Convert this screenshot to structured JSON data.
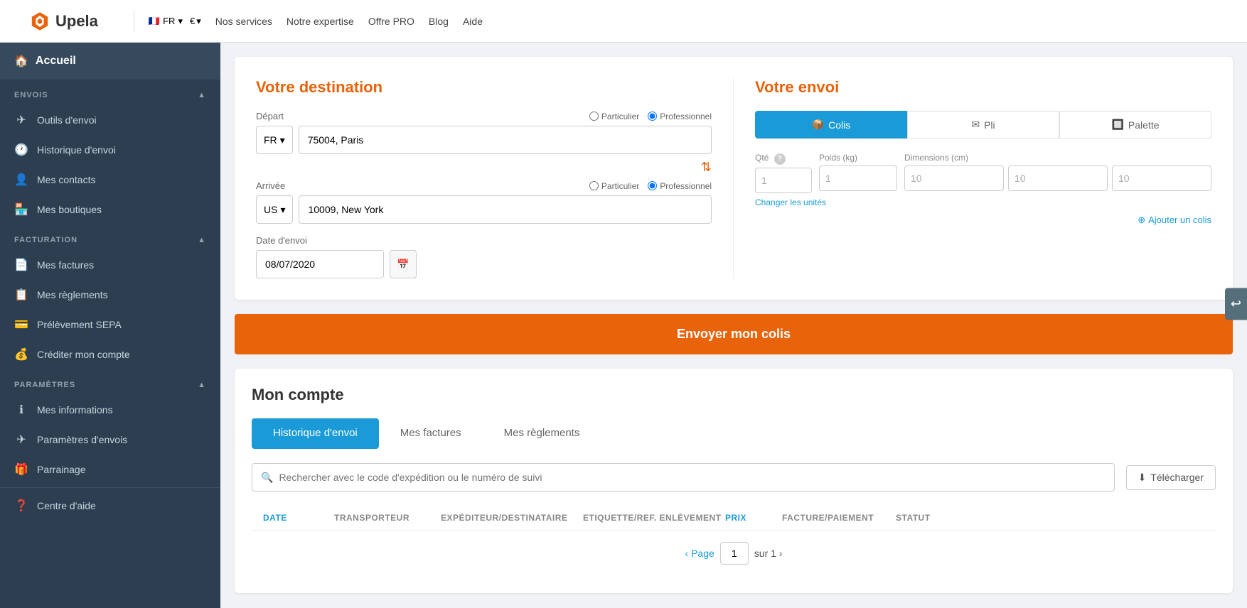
{
  "nav": {
    "logo_text": "Upela",
    "lang": "FR",
    "currency": "€",
    "links": [
      "Nos services",
      "Notre expertise",
      "Offre PRO",
      "Blog",
      "Aide"
    ]
  },
  "sidebar": {
    "home_label": "Accueil",
    "sections": [
      {
        "label": "ENVOIS",
        "items": [
          {
            "icon": "✈",
            "label": "Outils d'envoi"
          },
          {
            "icon": "🕐",
            "label": "Historique d'envoi"
          },
          {
            "icon": "👤",
            "label": "Mes contacts"
          },
          {
            "icon": "🏪",
            "label": "Mes boutiques"
          }
        ]
      },
      {
        "label": "FACTURATION",
        "items": [
          {
            "icon": "📄",
            "label": "Mes factures"
          },
          {
            "icon": "📋",
            "label": "Mes règlements"
          },
          {
            "icon": "💳",
            "label": "Prélèvement SEPA"
          },
          {
            "icon": "💰",
            "label": "Créditer mon compte"
          }
        ]
      },
      {
        "label": "PARAMÈTRES",
        "items": [
          {
            "icon": "ℹ",
            "label": "Mes informations"
          },
          {
            "icon": "✈",
            "label": "Paramètres d'envois"
          },
          {
            "icon": "🎁",
            "label": "Parrainage"
          }
        ]
      }
    ],
    "help_label": "Centre d'aide"
  },
  "destination": {
    "section_title": "Votre destination",
    "depart_label": "Départ",
    "depart_country": "FR",
    "depart_city": "75004, Paris",
    "particulier_label": "Particulier",
    "professionnel_label": "Professionnel",
    "arrivee_label": "Arrivée",
    "arrivee_country": "US",
    "arrivee_city": "10009, New York",
    "date_label": "Date d'envoi",
    "date_value": "08/07/2020"
  },
  "envoi": {
    "section_title": "Votre envoi",
    "tabs": [
      "Colis",
      "Pli",
      "Palette"
    ],
    "qty_label": "Qté",
    "weight_label": "Poids (kg)",
    "dimensions_label": "Dimensions (cm)",
    "qty_value": "1",
    "weight_value": "1",
    "dim1": "10",
    "dim2": "10",
    "dim3": "10",
    "change_units": "Changer les unités",
    "add_colis": "Ajouter un colis"
  },
  "send_button": "Envoyer mon colis",
  "account": {
    "title": "Mon compte",
    "tabs": [
      "Historique d'envoi",
      "Mes factures",
      "Mes règlements"
    ],
    "search_placeholder": "Rechercher avec le code d'expédition ou le numéro de suivi",
    "download_label": "Télécharger",
    "table_headers": [
      "DATE",
      "TRANSPORTEUR",
      "EXPÉDITEUR/DESTINATAIRE",
      "ETIQUETTE/REF. ENLÈVEMENT",
      "PRIX",
      "FACTURE/PAIEMENT",
      "STATUT"
    ],
    "pagination": {
      "prev": "‹ Page",
      "page_value": "1",
      "next": "sur 1 ›"
    }
  }
}
